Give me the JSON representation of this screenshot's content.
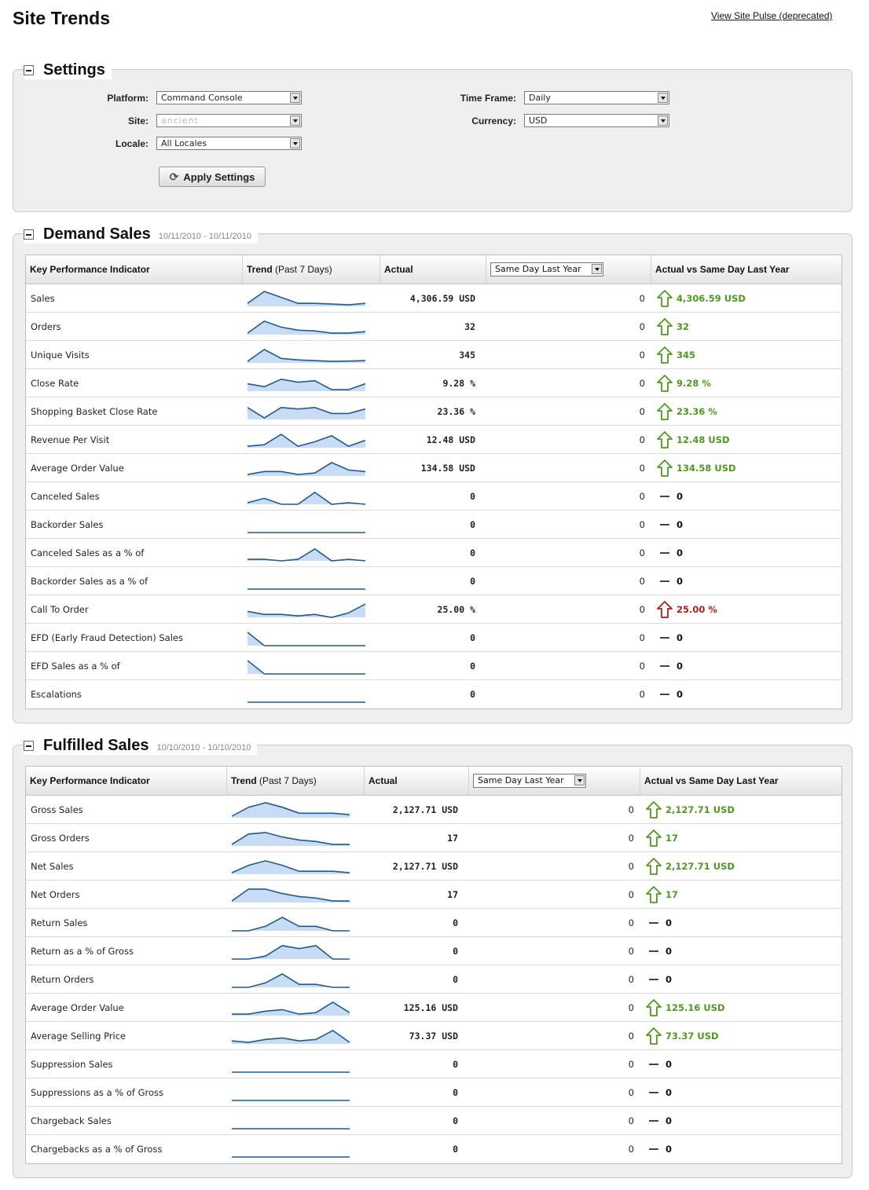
{
  "page": {
    "title": "Site Trends",
    "pulse_link": "View Site Pulse (deprecated)"
  },
  "settings": {
    "title": "Settings",
    "platform_label": "Platform:",
    "platform_value": "Command Console",
    "site_label": "Site:",
    "site_value": "ancient",
    "locale_label": "Locale:",
    "locale_value": "All Locales",
    "timeframe_label": "Time Frame:",
    "timeframe_value": "Daily",
    "currency_label": "Currency:",
    "currency_value": "USD",
    "apply_label": "Apply Settings",
    "apply_icon": "refresh-icon"
  },
  "colors": {
    "up": "#4e9a1e",
    "up_red": "#b01e1e",
    "spark_line": "#1f5a8f",
    "spark_fill": "#c9dcf5"
  },
  "demand": {
    "title": "Demand Sales",
    "date_range": "10/11/2010 - 10/11/2010",
    "headers": {
      "kpi": "Key Performance Indicator",
      "trend_bold": "Trend",
      "trend_rest": " (Past 7 Days)",
      "actual": "Actual",
      "compare_select": "Same Day Last Year",
      "delta": "Actual vs Same Day Last Year"
    },
    "rows": [
      {
        "name": "Sales",
        "actual": "4,306.59 USD",
        "last": "0",
        "delta": "4,306.59 USD",
        "trend": "up",
        "spark": [
          2,
          10,
          6,
          2,
          2,
          1.5,
          1,
          2
        ]
      },
      {
        "name": "Orders",
        "actual": "32",
        "last": "0",
        "delta": "32",
        "trend": "up",
        "spark": [
          1,
          9,
          5,
          3,
          2.5,
          1,
          1,
          2
        ]
      },
      {
        "name": "Unique Visits",
        "actual": "345",
        "last": "0",
        "delta": "345",
        "trend": "up",
        "spark": [
          1,
          9,
          3,
          2,
          1.5,
          1,
          1.2,
          1.5
        ]
      },
      {
        "name": "Close Rate",
        "actual": "9.28 %",
        "last": "0",
        "delta": "9.28 %",
        "trend": "up",
        "spark": [
          5,
          3,
          8,
          6,
          7,
          1,
          1,
          5
        ]
      },
      {
        "name": "Shopping Basket Close Rate",
        "actual": "23.36 %",
        "last": "0",
        "delta": "23.36 %",
        "trend": "up",
        "spark": [
          8,
          1,
          8,
          7,
          8,
          4,
          4,
          7
        ]
      },
      {
        "name": "Revenue Per Visit",
        "actual": "12.48 USD",
        "last": "0",
        "delta": "12.48 USD",
        "trend": "up",
        "spark": [
          1,
          2,
          9,
          1,
          4,
          8,
          1,
          5
        ]
      },
      {
        "name": "Average Order Value",
        "actual": "134.58 USD",
        "last": "0",
        "delta": "134.58 USD",
        "trend": "up",
        "spark": [
          1,
          3,
          3,
          1,
          2,
          9,
          4,
          3
        ]
      },
      {
        "name": "Canceled Sales",
        "actual": "0",
        "last": "0",
        "delta": "0",
        "trend": "flat",
        "spark": [
          1,
          4,
          0,
          0,
          8,
          0,
          1,
          0
        ]
      },
      {
        "name": "Backorder Sales",
        "actual": "0",
        "last": "0",
        "delta": "0",
        "trend": "flat",
        "spark": [
          0,
          0,
          0,
          0,
          0,
          0,
          0,
          0
        ]
      },
      {
        "name": "Canceled Sales as a % of",
        "actual": "0",
        "last": "0",
        "delta": "0",
        "trend": "flat",
        "spark": [
          1,
          1,
          0,
          1,
          8,
          0,
          1,
          0
        ]
      },
      {
        "name": "Backorder Sales as a % of",
        "actual": "0",
        "last": "0",
        "delta": "0",
        "trend": "flat",
        "spark": [
          0,
          0,
          0,
          0,
          0,
          0,
          0,
          0
        ]
      },
      {
        "name": "Call To Order",
        "actual": "25.00 %",
        "last": "0",
        "delta": "25.00 %",
        "trend": "up_red",
        "spark": [
          4,
          2,
          2,
          1,
          2,
          0,
          3,
          9
        ]
      },
      {
        "name": "EFD (Early Fraud Detection) Sales",
        "actual": "0",
        "last": "0",
        "delta": "0",
        "trend": "flat",
        "spark": [
          9,
          0,
          0,
          0,
          0,
          0,
          0,
          0
        ]
      },
      {
        "name": "EFD Sales as a % of",
        "actual": "0",
        "last": "0",
        "delta": "0",
        "trend": "flat",
        "spark": [
          9,
          0,
          0,
          0,
          0,
          0,
          0,
          0
        ]
      },
      {
        "name": "Escalations",
        "actual": "0",
        "last": "0",
        "delta": "0",
        "trend": "flat",
        "spark": [
          0,
          0,
          0,
          0,
          0,
          0,
          0,
          0
        ]
      }
    ]
  },
  "fulfilled": {
    "title": "Fulfilled Sales",
    "date_range": "10/10/2010 - 10/10/2010",
    "headers": {
      "kpi": "Key Performance Indicator",
      "trend_bold": "Trend",
      "trend_rest": " (Past 7 Days)",
      "actual": "Actual",
      "compare_select": "Same Day Last Year",
      "delta": "Actual vs Same Day Last Year"
    },
    "rows": [
      {
        "name": "Gross Sales",
        "actual": "2,127.71 USD",
        "last": "0",
        "delta": "2,127.71 USD",
        "trend": "up",
        "spark": [
          1,
          7,
          10,
          7,
          3,
          3,
          3,
          2
        ]
      },
      {
        "name": "Gross Orders",
        "actual": "17",
        "last": "0",
        "delta": "17",
        "trend": "up",
        "spark": [
          1,
          8,
          9,
          6,
          4,
          3,
          1,
          1
        ]
      },
      {
        "name": "Net Sales",
        "actual": "2,127.71 USD",
        "last": "0",
        "delta": "2,127.71 USD",
        "trend": "up",
        "spark": [
          1,
          6,
          9,
          6,
          2,
          2,
          2,
          1
        ]
      },
      {
        "name": "Net Orders",
        "actual": "17",
        "last": "0",
        "delta": "17",
        "trend": "up",
        "spark": [
          1,
          9,
          9,
          6,
          4,
          3,
          1,
          1
        ]
      },
      {
        "name": "Return Sales",
        "actual": "0",
        "last": "0",
        "delta": "0",
        "trend": "flat",
        "spark": [
          0,
          0,
          3,
          9,
          3,
          3,
          0,
          0
        ]
      },
      {
        "name": "Return as a % of Gross",
        "actual": "0",
        "last": "0",
        "delta": "0",
        "trend": "flat",
        "spark": [
          0,
          0,
          2,
          9,
          7,
          9,
          0,
          0
        ]
      },
      {
        "name": "Return Orders",
        "actual": "0",
        "last": "0",
        "delta": "0",
        "trend": "flat",
        "spark": [
          0,
          0,
          3,
          9,
          2,
          2,
          0,
          0
        ]
      },
      {
        "name": "Average Order Value",
        "actual": "125.16 USD",
        "last": "0",
        "delta": "125.16 USD",
        "trend": "up",
        "spark": [
          1,
          1,
          3,
          4,
          1,
          2,
          9,
          2
        ]
      },
      {
        "name": "Average Selling Price",
        "actual": "73.37 USD",
        "last": "0",
        "delta": "73.37 USD",
        "trend": "up",
        "spark": [
          2,
          1,
          3,
          4,
          2,
          3,
          9,
          1
        ]
      },
      {
        "name": "Suppression Sales",
        "actual": "0",
        "last": "0",
        "delta": "0",
        "trend": "flat",
        "spark": [
          0,
          0,
          0,
          0,
          0,
          0,
          0,
          0
        ]
      },
      {
        "name": "Suppressions as a % of Gross",
        "actual": "0",
        "last": "0",
        "delta": "0",
        "trend": "flat",
        "spark": [
          0,
          0,
          0,
          0,
          0,
          0,
          0,
          0
        ]
      },
      {
        "name": "Chargeback Sales",
        "actual": "0",
        "last": "0",
        "delta": "0",
        "trend": "flat",
        "spark": [
          0,
          0,
          0,
          0,
          0,
          0,
          0,
          0
        ]
      },
      {
        "name": "Chargebacks as a % of Gross",
        "actual": "0",
        "last": "0",
        "delta": "0",
        "trend": "flat",
        "spark": [
          0,
          0,
          0,
          0,
          0,
          0,
          0,
          0
        ]
      }
    ]
  }
}
